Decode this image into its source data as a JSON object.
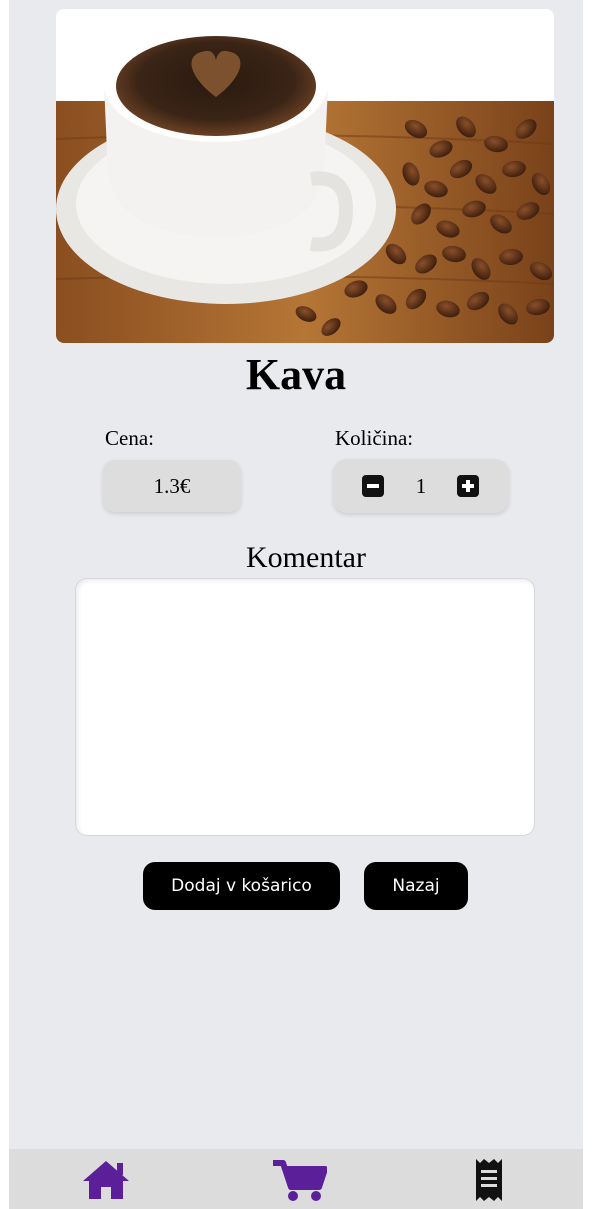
{
  "product": {
    "title": "Kava",
    "image_icon": "coffee-cup-photo"
  },
  "price": {
    "label": "Cena:",
    "value": "1.3€"
  },
  "quantity": {
    "label": "Količina:",
    "value": "1",
    "minus_icon": "minus-square-icon",
    "plus_icon": "plus-square-icon"
  },
  "comment": {
    "label": "Komentar",
    "value": "",
    "placeholder": ""
  },
  "actions": {
    "add_to_cart_label": "Dodaj v košarico",
    "back_label": "Nazaj"
  },
  "bottom_nav": {
    "items": [
      {
        "icon": "home-icon"
      },
      {
        "icon": "cart-icon"
      },
      {
        "icon": "receipt-icon"
      }
    ]
  },
  "colors": {
    "page_background": "#e9eaee",
    "nav_background": "#dcdcdc",
    "nav_accent": "#5b1f99",
    "button_background": "#000000",
    "button_text": "#ffffff"
  }
}
